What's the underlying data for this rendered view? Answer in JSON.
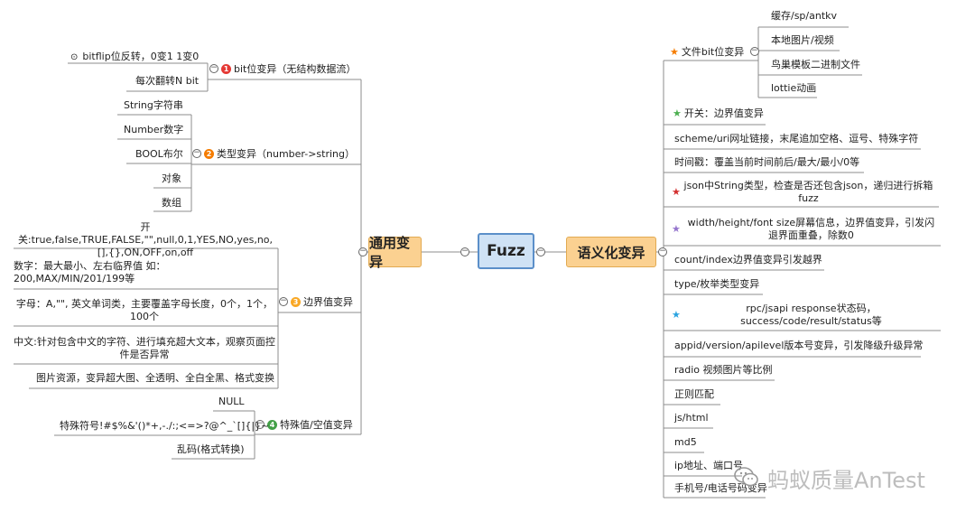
{
  "central": "Fuzz",
  "left_main": "通用变异",
  "right_main": "语义化变异",
  "left_branches": {
    "b1": {
      "badge": "1",
      "label": "bit位变异（无结构数据流）",
      "leaves": [
        "bitflip位反转，0变1 1变0",
        "每次翻转N bit"
      ]
    },
    "b2": {
      "badge": "2",
      "label": "类型变异（number->string）",
      "leaves": [
        "String字符串",
        "Number数字",
        "BOOL布尔",
        "对象",
        "数组"
      ]
    },
    "b3": {
      "badge": "3",
      "label": "边界值变异",
      "leaves": [
        "开关:true,false,TRUE,FALSE,\"\",null,0,1,YES,NO,yes,no,[],{},ON,OFF,on,off",
        "数字：最大最小、左右临界值 如：200,MAX/MIN/201/199等",
        "字母：A,\"\", 英文单词类，主要覆盖字母长度，0个，1个，100个",
        "中文:针对包含中文的字符、进行填充超大文本，观察页面控件是否异常",
        "图片资源，变异超大图、全透明、全白全黑、格式变换"
      ]
    },
    "b4": {
      "badge": "4",
      "label": "特殊值/空值变异",
      "leaves": [
        "NULL",
        "特殊符号!#$%&'()*+,-./:;<=>?@^_`[]{|}~",
        "乱码(格式转换)"
      ]
    }
  },
  "right_branches": {
    "r1": {
      "label": "文件bit位变异",
      "leaves": [
        "缓存/sp/antkv",
        "本地图片/视频",
        "鸟巢模板二进制文件",
        "lottie动画"
      ]
    },
    "r2": {
      "label": "开关：边界值变异"
    },
    "r3": {
      "label": "scheme/uri网址链接，末尾追加空格、逗号、特殊字符"
    },
    "r4": {
      "label": "时间戳：覆盖当前时间前后/最大/最小/0等"
    },
    "r5": {
      "label": "json中String类型，检查是否还包含json，递归进行拆箱fuzz"
    },
    "r6": {
      "label": "width/height/font size屏幕信息，边界值变异，引发闪退界面重叠，除数0"
    },
    "r7": {
      "label": "count/index边界值变异引发越界"
    },
    "r8": {
      "label": "type/枚举类型变异"
    },
    "r9": {
      "label": "rpc/jsapi response状态码，success/code/result/status等"
    },
    "r10": {
      "label": "appid/version/apilevel版本号变异，引发降级升级异常"
    },
    "r11": {
      "label": "radio 视频图片等比例"
    },
    "r12": {
      "label": "正则匹配"
    },
    "r13": {
      "label": "js/html"
    },
    "r14": {
      "label": "md5"
    },
    "r15": {
      "label": "ip地址、端口号"
    },
    "r16": {
      "label": "手机号/电话号码变异"
    }
  },
  "watermark": "蚂蚁质量AnTest",
  "colors": {
    "badge1": "#e53935",
    "badge2": "#f57c00",
    "badge3": "#f9a825",
    "badge4": "#43a047",
    "star_orange": "#f57c00",
    "star_green": "#4caf50",
    "star_red": "#d32f2f",
    "star_purple": "#9575cd",
    "star_blue": "#29a3e0"
  }
}
